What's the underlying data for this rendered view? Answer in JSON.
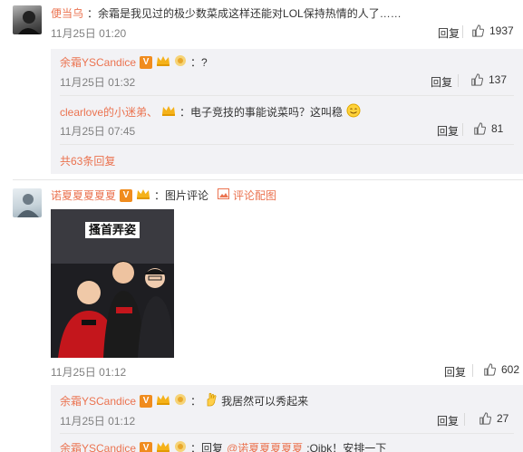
{
  "comments": [
    {
      "user": "便当乌",
      "text": "：余霜是我见过的极少数菜成这样还能对LOL保持热情的人了……",
      "time": "11月25日 01:20",
      "reply_label": "回复",
      "likes": "1937",
      "replies": [
        {
          "user": "余霜YSCandice",
          "text": "：?",
          "time": "11月25日 01:32",
          "reply_label": "回复",
          "likes": "137"
        },
        {
          "user": "clearlove的小迷弟、",
          "text": "：电子竞技的事能说菜吗？这叫稳",
          "time": "11月25日 07:45",
          "reply_label": "回复",
          "likes": "81"
        }
      ],
      "more_replies": "共63条回复"
    },
    {
      "user": "诺夏夏夏夏夏",
      "text": "：图片评论",
      "view_image_label": "评论配图",
      "image_caption": "搔首弄姿",
      "time": "11月25日 01:12",
      "reply_label": "回复",
      "likes": "602",
      "replies": [
        {
          "user": "余霜YSCandice",
          "text": "我居然可以秀起来",
          "time": "11月25日 01:12",
          "reply_label": "回复",
          "likes": "27"
        },
        {
          "user": "余霜YSCandice",
          "text_prefix": "：回复",
          "mention": "@诺夏夏夏夏夏",
          "text": ":Ojbk！安排一下"
        }
      ]
    }
  ],
  "colors": {
    "username": "#eb7350",
    "sub_background": "#f2f2f5",
    "verified_badge": "#f08c1e"
  },
  "icons": [
    "thumb-up-icon",
    "verified-v-icon",
    "crown-icon",
    "membership-icon",
    "smiley-emoji-icon",
    "ok-hand-emoji-icon",
    "picture-icon"
  ]
}
